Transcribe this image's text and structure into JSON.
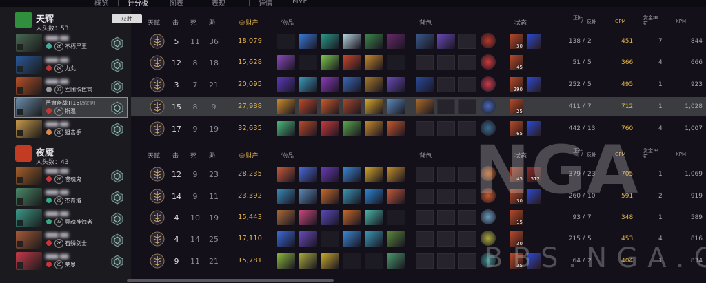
{
  "nav": {
    "tabs": [
      "概览",
      "计分板",
      "图表",
      "表现",
      "详情",
      "MVP"
    ],
    "active": 1
  },
  "headers": {
    "talent": "天赋",
    "kills": "击",
    "deaths": "死",
    "assists": "助",
    "networth": "财产",
    "items": "物品",
    "backpack": "背包",
    "buffs": "状态",
    "lasthits": "正补",
    "slash": "/",
    "denies": "反补",
    "gpm": "GPM",
    "bounty": "赏金神符",
    "xpm": "XPM"
  },
  "colors": {
    "gold": "#e3b44b",
    "radiant": "#3fbf3f",
    "dire": "#c23b22"
  },
  "teams": [
    {
      "name": "天辉",
      "kills_label": "人头数：",
      "kills": "53",
      "result": "获胜",
      "icon_color": "#2f8f3c",
      "players": [
        {
          "hero_color": "#4a6a55",
          "name": "",
          "title": "不朽尸王",
          "level": "26",
          "rank_color": "#4a9",
          "selected": false,
          "k": "5",
          "d": "11",
          "a": "36",
          "nw": "18,079",
          "lh": "138",
          "dn": "2",
          "gpm": "451",
          "bounty": "7",
          "xpm": "844",
          "items": [
            "#1c1a22",
            "#3a7ad8",
            "#2a9a88",
            "#b9d8e0",
            "#3c8a4a",
            "#6a2a6a"
          ],
          "backpack": [
            "#3a5a8a",
            "#6a4ab8",
            null
          ],
          "neutral": "#b8382a",
          "buffs": [
            {
              "c": "#b84a2a",
              "n": "30"
            },
            {
              "c": "#2a4ad8",
              "n": ""
            }
          ]
        },
        {
          "hero_color": "#2a5a9a",
          "name": "",
          "title": "力丸",
          "level": "24",
          "rank_color": "#b33",
          "selected": false,
          "k": "12",
          "d": "8",
          "a": "18",
          "nw": "15,628",
          "lh": "51",
          "dn": "5",
          "gpm": "366",
          "bounty": "4",
          "xpm": "666",
          "items": [
            "#8a4ab8",
            "#1c1a22",
            "#7ac84a",
            "#c8482a",
            "#c88a2a",
            "#1c1a22"
          ],
          "backpack": [
            null,
            null,
            null
          ],
          "neutral": "#c83a3a",
          "buffs": [
            {
              "c": "#b84a2a",
              "n": "45"
            }
          ]
        },
        {
          "hero_color": "#b8502a",
          "name": "",
          "title": "军团指挥官",
          "level": "27",
          "rank_color": "#999",
          "selected": false,
          "k": "3",
          "d": "7",
          "a": "21",
          "nw": "20,095",
          "lh": "252",
          "dn": "5",
          "gpm": "495",
          "bounty": "1",
          "xpm": "923",
          "items": [
            "#5a3ab8",
            "#3a9ab8",
            "#8a3ab8",
            "#3a6ab8",
            "#a87a2a",
            "#6a4ab8"
          ],
          "backpack": [
            "#2a4a9a",
            null,
            null
          ],
          "neutral": "#c83a4a",
          "buffs": [
            {
              "c": "#b84a2a",
              "n": "290"
            },
            {
              "c": "#2a4ad8",
              "n": ""
            }
          ]
        },
        {
          "hero_color": "#6a8aa8",
          "name": "严肃备战TI15",
          "tag": "[战安伊]",
          "title": "斯温",
          "level": "25",
          "rank_color": "#c33",
          "selected": true,
          "k": "15",
          "d": "8",
          "a": "9",
          "nw": "27,988",
          "lh": "411",
          "dn": "7",
          "gpm": "712",
          "bounty": "1",
          "xpm": "1,028",
          "items": [
            "#c88a2a",
            "#b84a2a",
            "#c85a2a",
            "#a8482a",
            "#d8a82a",
            "#5a8ab8"
          ],
          "backpack": [
            "#a86a2a",
            null,
            null
          ],
          "neutral": "#4a6ab8",
          "buffs": [
            {
              "c": "#b84a2a",
              "n": "25"
            }
          ]
        },
        {
          "hero_color": "#c89a4a",
          "name": "",
          "title": "狙击手",
          "level": "28",
          "rank_color": "#d84",
          "selected": false,
          "k": "17",
          "d": "9",
          "a": "19",
          "nw": "32,635",
          "lh": "442",
          "dn": "13",
          "gpm": "760",
          "bounty": "4",
          "xpm": "1,007",
          "items": [
            "#4ab87a",
            "#b84a2a",
            "#c83a3a",
            "#5aa84a",
            "#c88a2a",
            "#c8582a"
          ],
          "backpack": [
            null,
            null,
            null
          ],
          "neutral": "#3a6a8a",
          "buffs": [
            {
              "c": "#b84a2a",
              "n": "65"
            },
            {
              "c": "#2a4ad8",
              "n": ""
            }
          ]
        }
      ]
    },
    {
      "name": "夜魇",
      "kills_label": "人头数：",
      "kills": "43",
      "result": "",
      "icon_color": "#c23b22",
      "players": [
        {
          "hero_color": "#a8602a",
          "name": "",
          "title": "噬魂鬼",
          "level": "28",
          "rank_color": "#c33",
          "selected": false,
          "k": "12",
          "d": "9",
          "a": "23",
          "nw": "28,235",
          "lh": "379",
          "dn": "23",
          "gpm": "705",
          "bounty": "1",
          "xpm": "1,069",
          "items": [
            "#c85a3a",
            "#4a6ad8",
            "#6a3ab8",
            "#3a8ad8",
            "#d8a82a",
            "#c8902a"
          ],
          "backpack": [
            null,
            null,
            null
          ],
          "neutral": "#c86a2a",
          "buffs": [
            {
              "c": "#b84a2a",
              "n": "45"
            },
            {
              "c": "#8a2a2a",
              "n": "512"
            }
          ]
        },
        {
          "hero_color": "#4a8a6a",
          "name": "",
          "title": "杰奇洛",
          "level": "29",
          "rank_color": "#3a8",
          "selected": false,
          "k": "14",
          "d": "9",
          "a": "11",
          "nw": "23,392",
          "lh": "260",
          "dn": "10",
          "gpm": "591",
          "bounty": "2",
          "xpm": "919",
          "items": [
            "#3a8ab8",
            "#5a8ab8",
            "#c86a2a",
            "#3a9ab8",
            "#2a8ad8",
            "#c85a3a"
          ],
          "backpack": [
            null,
            null,
            null
          ],
          "neutral": "#c8582a",
          "buffs": [
            {
              "c": "#b84a2a",
              "n": "30"
            },
            {
              "c": "#2a4ad8",
              "n": ""
            }
          ]
        },
        {
          "hero_color": "#3a9a8a",
          "name": "",
          "title": "冥魂神蚀者",
          "level": "23",
          "rank_color": "#3a8",
          "selected": false,
          "k": "4",
          "d": "10",
          "a": "19",
          "nw": "15,443",
          "lh": "93",
          "dn": "7",
          "gpm": "348",
          "bounty": "1",
          "xpm": "589",
          "items": [
            "#a86a3a",
            "#c8487a",
            "#5a4ab8",
            "#c86a2a",
            "#4ab8a8",
            "#1c1a22"
          ],
          "backpack": [
            null,
            null,
            null
          ],
          "neutral": "#6a9ab8",
          "buffs": [
            {
              "c": "#b84a2a",
              "n": "15"
            }
          ]
        },
        {
          "hero_color": "#a85a3a",
          "name": "",
          "title": "石鳞剑士",
          "level": "26",
          "rank_color": "#c33",
          "selected": false,
          "k": "4",
          "d": "14",
          "a": "25",
          "nw": "17,110",
          "lh": "215",
          "dn": "5",
          "gpm": "453",
          "bounty": "4",
          "xpm": "816",
          "items": [
            "#3a6ad8",
            "#6a4ab8",
            "#1c1a22",
            "#3a8ad8",
            "#3a9ab8",
            "#5a8a3a"
          ],
          "backpack": [
            null,
            null,
            null
          ],
          "neutral": "#a8a83a",
          "buffs": [
            {
              "c": "#b84a2a",
              "n": "30"
            }
          ]
        },
        {
          "hero_color": "#c83a4a",
          "name": "",
          "title": "莱恩",
          "level": "25",
          "rank_color": "#c33",
          "selected": false,
          "k": "9",
          "d": "11",
          "a": "21",
          "nw": "15,781",
          "lh": "64",
          "dn": "2",
          "gpm": "404",
          "bounty": "1",
          "xpm": "834",
          "items": [
            "#8ab83a",
            "#a8a83a",
            "#c8a82a",
            "#1c1a22",
            "#1c1a22",
            "#4a9a6a"
          ],
          "backpack": [
            null,
            null,
            null
          ],
          "neutral": "#3a8a8a",
          "buffs": [
            {
              "c": "#b84a2a",
              "n": "35"
            },
            {
              "c": "#2a4ad8",
              "n": ""
            }
          ]
        }
      ]
    }
  ],
  "watermark": {
    "big": "NGA",
    "small": "BBS.NGA.CN"
  }
}
